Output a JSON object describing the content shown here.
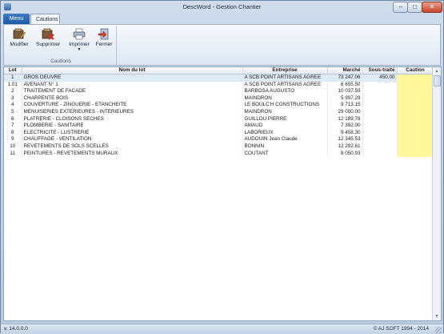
{
  "window": {
    "title": "DescWord - Gestion Chantier"
  },
  "tabs": {
    "menu": "Menu",
    "cautions": "Cautions"
  },
  "ribbon": {
    "buttons": {
      "modifier": "Modifier",
      "supprimer": "Supprimer",
      "imprimer": "Imprimer",
      "fermer": "Fermer"
    },
    "group_label": "Cautions"
  },
  "table": {
    "headers": {
      "lot": "Lot",
      "nom": "Nom du lot",
      "entreprise": "Entreprise",
      "marche": "Marché",
      "sous_traite": "Sous-traité",
      "caution": "Caution"
    },
    "rows": [
      {
        "lot": "1",
        "nom": "GROS OEUVRE",
        "entreprise": "A SCB POINT ARTISANS AGREE",
        "marche": "73 247.06",
        "sous_traite": "450.00",
        "caution": ""
      },
      {
        "lot": "1.01",
        "nom": "AVENANT N° 1",
        "entreprise": "A SCB POINT ARTISANS AGREE",
        "marche": "6 655.50",
        "sous_traite": "",
        "caution": ""
      },
      {
        "lot": "2",
        "nom": "TRAITEMENT DE FACADE",
        "entreprise": "BARBOSA AUGUSTO",
        "marche": "10 037.59",
        "sous_traite": "",
        "caution": ""
      },
      {
        "lot": "3",
        "nom": "CHARPENTE BOIS",
        "entreprise": "MAINDRON",
        "marche": "5 997.29",
        "sous_traite": "",
        "caution": ""
      },
      {
        "lot": "4",
        "nom": "COUVERTURE - ZINGUERIE - ETANCHEITE",
        "entreprise": "LE BOULC'H CONSTRUCTIONS",
        "marche": "9 713.15",
        "sous_traite": "",
        "caution": ""
      },
      {
        "lot": "5",
        "nom": "MENUISERIES EXTERIEURES - INTERIEURES",
        "entreprise": "MAINDRON",
        "marche": "29 000.00",
        "sous_traite": "",
        "caution": ""
      },
      {
        "lot": "6",
        "nom": "PLATRERIE - CLOISONS SECHES",
        "entreprise": "GUILLOU PIERRE",
        "marche": "12 189.78",
        "sous_traite": "",
        "caution": ""
      },
      {
        "lot": "7",
        "nom": "PLOMBERIE - SANITAIRE",
        "entreprise": "AMAUD",
        "marche": "7 392.00",
        "sous_traite": "",
        "caution": ""
      },
      {
        "lot": "8",
        "nom": "ELECTRICITE - LUSTRERIE",
        "entreprise": "LABORIEUX",
        "marche": "9 458.30",
        "sous_traite": "",
        "caution": ""
      },
      {
        "lot": "9",
        "nom": "CHAUFFAGE - VENTILATION",
        "entreprise": "AUDOUIN Jean Claude",
        "marche": "12 345.53",
        "sous_traite": "",
        "caution": ""
      },
      {
        "lot": "10",
        "nom": "REVETEMENTS DE SOLS SCELLES",
        "entreprise": "BONNIN",
        "marche": "12 292.61",
        "sous_traite": "",
        "caution": ""
      },
      {
        "lot": "11",
        "nom": "PEINTURES - REVETEMENTS MURAUX",
        "entreprise": "COUTANT",
        "marche": "8 050.93",
        "sous_traite": "",
        "caution": ""
      }
    ]
  },
  "status": {
    "version": "v. 14.0.0.0",
    "copyright": "© AJ SOFT 1994 - 2014"
  },
  "colors": {
    "caution_cell": "#fff79a",
    "menu_tab": "#1f5aa5",
    "selected_row": "#dfeaf7"
  }
}
